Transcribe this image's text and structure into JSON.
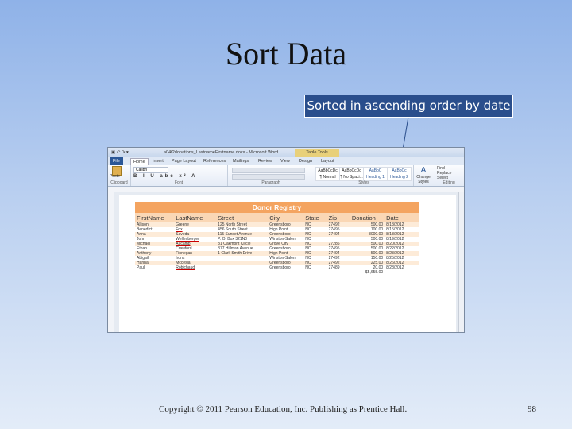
{
  "slide": {
    "title": "Sort Data",
    "callout": "Sorted in ascending order by date",
    "footer": "Copyright © 2011 Pearson Education, Inc. Publishing as Prentice Hall.",
    "page_number": "98"
  },
  "window": {
    "title": "a04t2donations_LastnameFirstname.docx - Microsoft Word",
    "context_tab": "Table Tools",
    "tabs": [
      "File",
      "Home",
      "Insert",
      "Page Layout",
      "References",
      "Mailings",
      "Review",
      "View",
      "Design",
      "Layout"
    ],
    "ribbon_groups": [
      "Clipboard",
      "Font",
      "Paragraph",
      "Styles",
      "Editing"
    ],
    "font_name": "Calibri",
    "paste_label": "Paste",
    "styles": [
      {
        "preview": "AaBbCcDc",
        "name": "¶ Normal"
      },
      {
        "preview": "AaBbCcDc",
        "name": "¶ No Spaci..."
      },
      {
        "preview": "AaBbC",
        "name": "Heading 1"
      },
      {
        "preview": "AaBbCc",
        "name": "Heading 2"
      }
    ],
    "change_styles": "Change Styles",
    "editing": [
      "Find",
      "Replace",
      "Select"
    ]
  },
  "table": {
    "title": "Donor Registry",
    "headers": [
      "FirstName",
      "LastName",
      "Street",
      "City",
      "State",
      "Zip",
      "Donation",
      "Date"
    ],
    "rows": [
      [
        "Allison",
        "Greene",
        "125 North Street",
        "Greensboro",
        "NC",
        "27492",
        "500.00",
        "8/13/2012"
      ],
      [
        "Benedict",
        "Fox",
        "456 South Street",
        "High Point",
        "NC",
        "27495",
        "100.00",
        "8/15/2012"
      ],
      [
        "Anna",
        "Saveda",
        "115 Sunset Avenue",
        "Greensboro",
        "NC",
        "27494",
        "3000.00",
        "8/18/2012"
      ],
      [
        "John",
        "Wellenberger",
        "P. O. Box 321N0",
        "Winston-Salem",
        "NC",
        "",
        "500.00",
        "8/19/2012"
      ],
      [
        "Michael",
        "Aucamp",
        "31 Oakmont Circle",
        "Grove City",
        "NC",
        "27286",
        "500.00",
        "8/20/2012"
      ],
      [
        "Ethan",
        "Crawford",
        "377 Hillman Avenue",
        "Greensboro",
        "NC",
        "27495",
        "500.00",
        "8/22/2012"
      ],
      [
        "Anthony",
        "Finnegan",
        "1 Clark Smith Drive",
        "High Point",
        "NC",
        "27494",
        "500.00",
        "8/23/2012"
      ],
      [
        "Abigail",
        "Irons",
        "",
        "Winston-Salem",
        "NC",
        "27492",
        "150.00",
        "8/25/2012"
      ],
      [
        "Hanna",
        "Mccesia",
        "",
        "Greensboro",
        "NC",
        "27492",
        "225.00",
        "8/26/2012"
      ],
      [
        "Paul",
        "Robichaud",
        "",
        "Greensboro",
        "NC",
        "27489",
        "20.00",
        "8/28/2012"
      ]
    ],
    "total": "$5,655.00"
  }
}
